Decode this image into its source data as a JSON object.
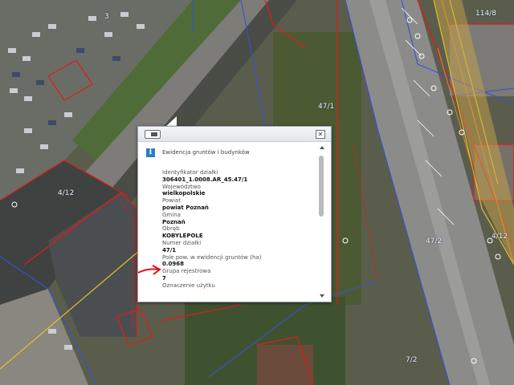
{
  "map": {
    "parcel_labels": [
      "114/8",
      "47/1",
      "47/2",
      "7/2",
      "4/12",
      "4/12",
      "3"
    ]
  },
  "popup": {
    "title": "Ewidencja gruntów i budynków",
    "toggle_icon": "collapse-toggle-icon",
    "close_icon": "close-icon",
    "info_icon": "info-icon",
    "fields": [
      {
        "label": "Identyfikator działki",
        "value": "306401_1.0008.AR_45.47/1"
      },
      {
        "label": "Województwo",
        "value": "wielkopolskie"
      },
      {
        "label": "Powiat",
        "value": "powiat Poznań"
      },
      {
        "label": "Gmina",
        "value": "Poznań"
      },
      {
        "label": "Obręb",
        "value": "KOBYLEPOLE"
      },
      {
        "label": "Numer działki",
        "value": "47/1"
      },
      {
        "label": "Pole pow. w ewidencji gruntów (ha)",
        "value": "0.0968"
      },
      {
        "label": "Grupa rejestrowa",
        "value": "7"
      },
      {
        "label": "Oznaczenie użytku",
        "value": ""
      }
    ]
  },
  "annotation": {
    "arrow_color": "#e0101a"
  }
}
